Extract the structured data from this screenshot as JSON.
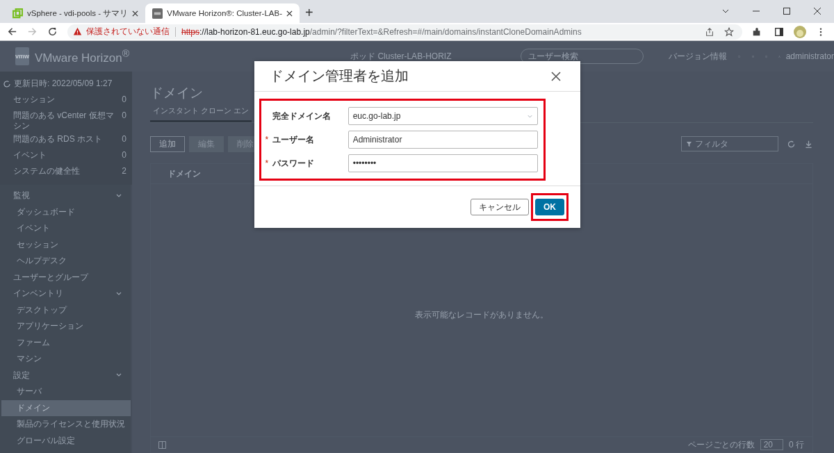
{
  "browser": {
    "tabs": [
      {
        "title": "vSphere - vdi-pools - サマリ",
        "selected": false
      },
      {
        "title": "VMware Horizon®: Cluster-LAB-",
        "selected": true
      }
    ],
    "new_tab": "+",
    "address": {
      "security": "保護されていない通信",
      "scheme": "https",
      "host": "://lab-horizon-81.euc.go-lab.jp",
      "path": "/admin/?filterText=&Refresh=#/main/domains/instantCloneDomainAdmins"
    }
  },
  "header": {
    "logo_text": "vmw",
    "product": "VMware Horizon$^{®}$",
    "pod": "ポッド Cluster-LAB-HORIZ",
    "search": {
      "placeholder": "ユーザー検索"
    },
    "about": "バージョン情報",
    "user": "administrator"
  },
  "sidebar": {
    "updated": "更新日時: 2022/05/09 1:27",
    "summary": [
      {
        "label": "セッション",
        "count": "0"
      },
      {
        "label": "問題のある vCenter 仮想マシン",
        "count": "0"
      },
      {
        "label": "問題のある RDS ホスト",
        "count": "0"
      },
      {
        "label": "イベント",
        "count": "0"
      },
      {
        "label": "システムの健全性",
        "count": "2"
      }
    ],
    "sections": [
      {
        "label": "監視",
        "kind": "group",
        "expanded": true,
        "children": [
          {
            "label": "ダッシュボード",
            "selected": false
          },
          {
            "label": "イベント",
            "selected": false
          },
          {
            "label": "セッション",
            "selected": false
          },
          {
            "label": "ヘルプデスク",
            "selected": false
          }
        ]
      },
      {
        "label": "ユーザーとグループ",
        "kind": "link"
      },
      {
        "label": "インベントリ",
        "kind": "group",
        "expanded": true,
        "children": [
          {
            "label": "デスクトップ",
            "selected": false
          },
          {
            "label": "アプリケーション",
            "selected": false
          },
          {
            "label": "ファーム",
            "selected": false
          },
          {
            "label": "マシン",
            "selected": false
          }
        ]
      },
      {
        "label": "設定",
        "kind": "group",
        "expanded": true,
        "children": [
          {
            "label": "サーバ",
            "selected": false
          },
          {
            "label": "ドメイン",
            "selected": true
          },
          {
            "label": "製品のライセンスと使用状況",
            "selected": false
          },
          {
            "label": "グローバル設定",
            "selected": false
          }
        ]
      }
    ]
  },
  "main": {
    "title": "ドメイン",
    "tabs": [
      {
        "label": "インスタント クローン エン",
        "selected": true
      }
    ],
    "actions": [
      {
        "label": "追加",
        "disabled": false
      },
      {
        "label": "編集",
        "disabled": true
      },
      {
        "label": "削除",
        "disabled": true
      }
    ],
    "filter": {
      "placeholder": "フィルタ"
    },
    "table": {
      "columns": [
        "ドメイン"
      ],
      "empty": "表示可能なレコードがありません。"
    },
    "footer": {
      "rows_label": "ページごとの行数",
      "page_size": "20",
      "count": "0 行"
    }
  },
  "dialog": {
    "title": "ドメイン管理者を追加",
    "fields_highlighted": true,
    "fields": [
      {
        "label": "完全ドメイン名",
        "kind": "select",
        "value": "euc.go-lab.jp"
      },
      {
        "label": "ユーザー名",
        "kind": "text",
        "mark": "*",
        "value": "Administrator"
      },
      {
        "label": "パスワード",
        "kind": "text",
        "mark": "*",
        "value": "••••••••"
      }
    ],
    "buttons": [
      {
        "label": "キャンセル",
        "kind": "secondary",
        "highlighted": false
      },
      {
        "label": "OK",
        "kind": "primary",
        "highlighted": true
      }
    ]
  }
}
